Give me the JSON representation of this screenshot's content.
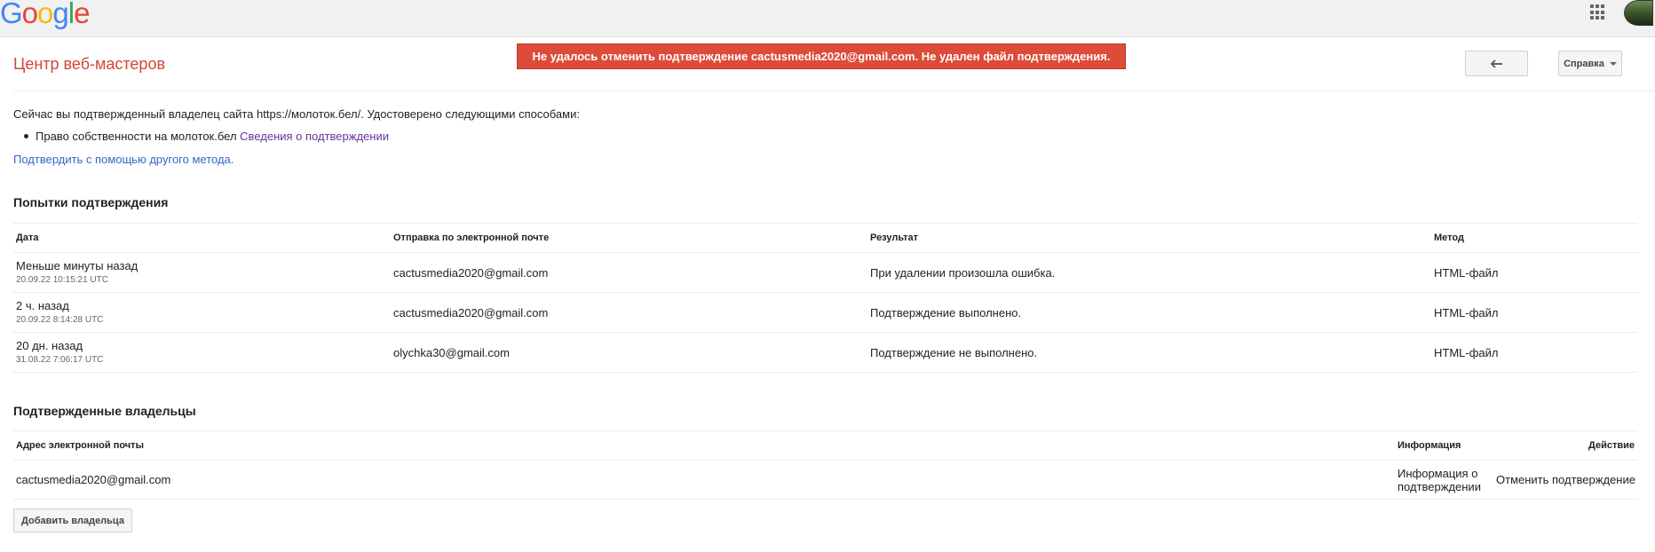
{
  "header": {
    "logo_letters": [
      {
        "ch": "G",
        "color": "#4285f4"
      },
      {
        "ch": "o",
        "color": "#ea4335"
      },
      {
        "ch": "o",
        "color": "#fbbc05"
      },
      {
        "ch": "g",
        "color": "#4285f4"
      },
      {
        "ch": "l",
        "color": "#34a853"
      },
      {
        "ch": "e",
        "color": "#ea4335"
      }
    ],
    "apps_icon": "apps-grid-icon",
    "avatar_icon": "user-avatar"
  },
  "app": {
    "title": "Центр веб-мастеров",
    "error_message": "Не удалось отменить подтверждение cactusmedia2020@gmail.com. Не удален файл подтверждения.",
    "back_icon": "back-arrow-icon",
    "help_label": "Справка"
  },
  "ownership": {
    "status_text": "Сейчас вы подтвержденный владелец сайта https://молоток.бел/. Удостоверено следующими способами:",
    "method_text": "Право собственности на молоток.бел",
    "method_link": "Сведения о подтверждении",
    "alt_method_link": "Подтвердить с помощью другого метода."
  },
  "attempts": {
    "title": "Попытки подтверждения",
    "headers": [
      "Дата",
      "Отправка по электронной почте",
      "Результат",
      "Метод"
    ],
    "rows": [
      {
        "date": "Меньше минуты назад",
        "timestamp": "20.09.22 10:15:21 UTC",
        "email": "cactusmedia2020@gmail.com",
        "result": "При удалении произошла ошибка.",
        "method": "HTML-файл"
      },
      {
        "date": "2 ч. назад",
        "timestamp": "20.09.22 8:14:28 UTC",
        "email": "cactusmedia2020@gmail.com",
        "result": "Подтверждение выполнено.",
        "method": "HTML-файл"
      },
      {
        "date": "20 дн. назад",
        "timestamp": "31.08.22 7:06:17 UTC",
        "email": "olychka30@gmail.com",
        "result": "Подтверждение не выполнено.",
        "method": "HTML-файл"
      }
    ]
  },
  "owners": {
    "title": "Подтвержденные владельцы",
    "headers": {
      "email": "Адрес электронной почты",
      "info": "Информация",
      "action": "Действие"
    },
    "rows": [
      {
        "email": "cactusmedia2020@gmail.com",
        "info_link_line1": "Информация о",
        "info_link_line2": "подтверждении",
        "action_link": "Отменить подтверждение"
      }
    ],
    "add_owner_label": "Добавить владельца"
  }
}
